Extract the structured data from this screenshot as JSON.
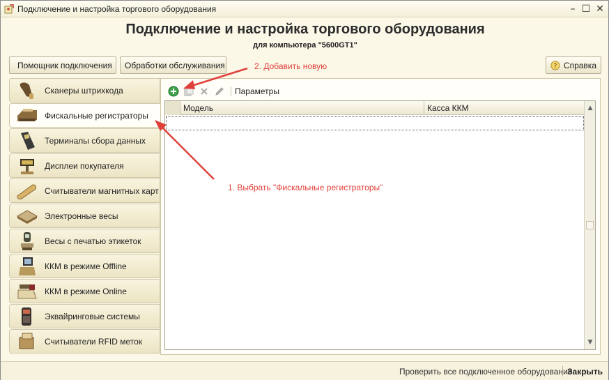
{
  "window": {
    "title": "Подключение и настройка торгового оборудования",
    "controls": [
      "–",
      "☐",
      "✕"
    ]
  },
  "header": {
    "title": "Подключение и настройка торгового оборудования",
    "subtitle": "для компьютера \"5600GT1\""
  },
  "buttons": {
    "wizard_label": "Помощник подключения",
    "maintenance_label": "Обработки обслуживания",
    "help_label": "Справка"
  },
  "annotations": {
    "step2": "2. Добавить новую",
    "step1": "1. Выбрать \"Фискальные регистраторы\"",
    "color": "#e0403a"
  },
  "sidebar": {
    "items": [
      {
        "label": "Сканеры штрихкода",
        "icon": "barcode-scanner-icon",
        "active": false
      },
      {
        "label": "Фискальные регистраторы",
        "icon": "fiscal-printer-icon",
        "active": true
      },
      {
        "label": "Терминалы сбора данных",
        "icon": "data-terminal-icon",
        "active": false
      },
      {
        "label": "Дисплеи покупателя",
        "icon": "customer-display-icon",
        "active": false
      },
      {
        "label": "Считыватели магнитных карт",
        "icon": "card-reader-icon",
        "active": false
      },
      {
        "label": "Электронные весы",
        "icon": "scales-icon",
        "active": false
      },
      {
        "label": "Весы с печатью этикеток",
        "icon": "label-scales-icon",
        "active": false
      },
      {
        "label": "ККМ в режиме Offline",
        "icon": "cash-register-offline-icon",
        "active": false
      },
      {
        "label": "ККМ в режиме Online",
        "icon": "cash-register-online-icon",
        "active": false
      },
      {
        "label": "Эквайринговые системы",
        "icon": "pos-terminal-icon",
        "active": false
      },
      {
        "label": "Считыватели RFID меток",
        "icon": "rfid-reader-icon",
        "active": false
      }
    ]
  },
  "toolbar": {
    "params_label": "Параметры"
  },
  "table": {
    "columns": [
      "Модель",
      "Касса ККМ"
    ],
    "rows": []
  },
  "status": {
    "check_all_label": "Проверить все подключенное оборудование",
    "close_label": "Закрыть"
  }
}
